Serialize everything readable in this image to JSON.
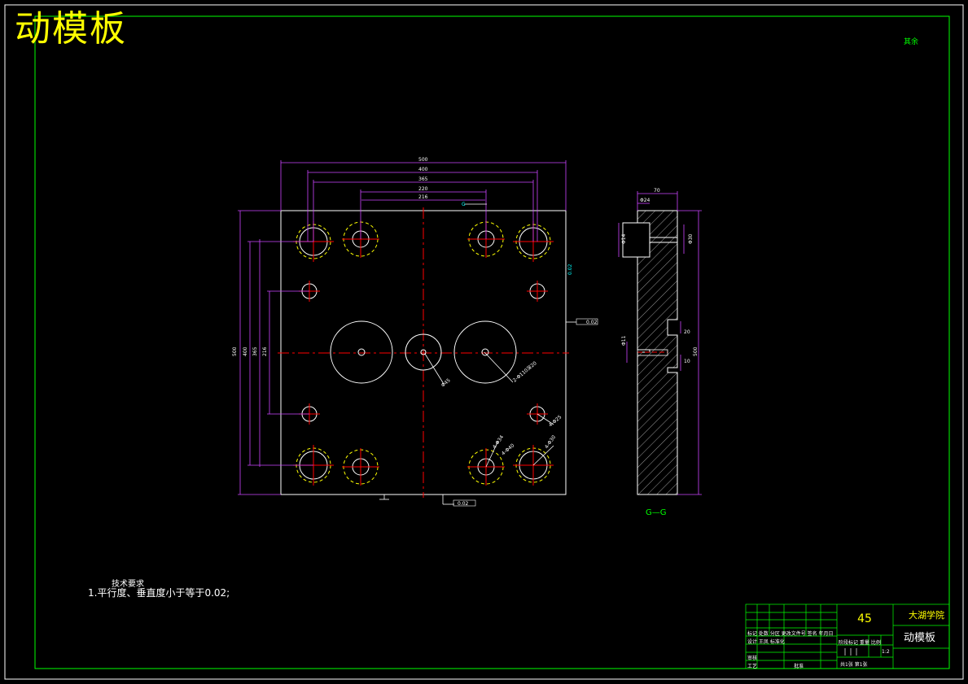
{
  "title": "动模板",
  "surface_roughness": "其余",
  "technical_requirements": {
    "heading": "技术要求",
    "items": [
      "1.平行度、垂直度小于等于0.02;"
    ]
  },
  "section_label": "G—G",
  "title_block": {
    "material": "45",
    "school": "大湖学院",
    "part_name": "动模板",
    "mark_row": "标记 处数 分区 更改文件号 签名 年月日",
    "design_row": "设计 王凤  标准化",
    "review": "审核",
    "process": "工艺",
    "approve": "批准",
    "stage_row": "阶段标记  重量  比例",
    "scale": "1:2",
    "sheet_row": "共1张   第1张"
  },
  "dimensions": {
    "top": [
      "500",
      "400",
      "365",
      "220",
      "216"
    ],
    "left": [
      "500",
      "400",
      "365",
      "216"
    ],
    "side_top": "70",
    "side_right": "500",
    "side_a": "Φ24",
    "side_b": "Φ30",
    "side_c": "Φ14",
    "side_d": "20",
    "side_e": "10",
    "side_f": "Φ11"
  },
  "callouts": {
    "big_holes": "2-Φ110深20",
    "center_hole": "Φ45",
    "guide_holes": "4-Φ25",
    "pin_holes": "4-Φ30",
    "pin_outer": "4-Φ34",
    "guide_outer": "4-Φ40",
    "flatness": "0.02",
    "perp_side": "0.02",
    "perp_bottom": "0.02",
    "section_mark": "G"
  }
}
